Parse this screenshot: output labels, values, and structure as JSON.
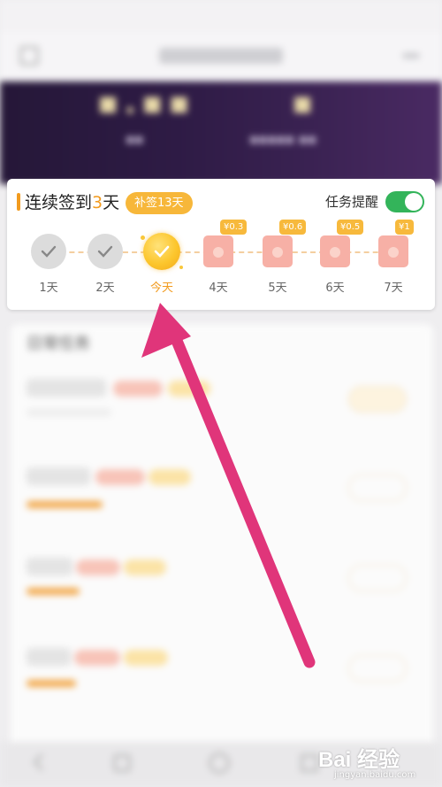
{
  "signin": {
    "title_prefix": "连续签到",
    "streak": "3",
    "title_suffix": "天",
    "makeup_label": "补签13天",
    "reminder_label": "任务提醒",
    "reminder_on": true,
    "accent_color": "#f29b1f",
    "toggle_color": "#33b45a",
    "days": [
      {
        "label": "1天",
        "state": "done",
        "reward": ""
      },
      {
        "label": "2天",
        "state": "done",
        "reward": ""
      },
      {
        "label": "今天",
        "state": "today",
        "reward": ""
      },
      {
        "label": "4天",
        "state": "upcoming",
        "reward": "¥0.3"
      },
      {
        "label": "5天",
        "state": "upcoming",
        "reward": "¥0.6"
      },
      {
        "label": "6天",
        "state": "upcoming",
        "reward": "¥0.5"
      },
      {
        "label": "7天",
        "state": "upcoming",
        "reward": "¥1"
      }
    ]
  },
  "daily_tasks": {
    "title": "日常任务"
  },
  "annotation": {
    "arrow_color": "#e0357a"
  },
  "watermark": {
    "brand": "Bai 经验",
    "url": "jingyan.baidu.com"
  }
}
